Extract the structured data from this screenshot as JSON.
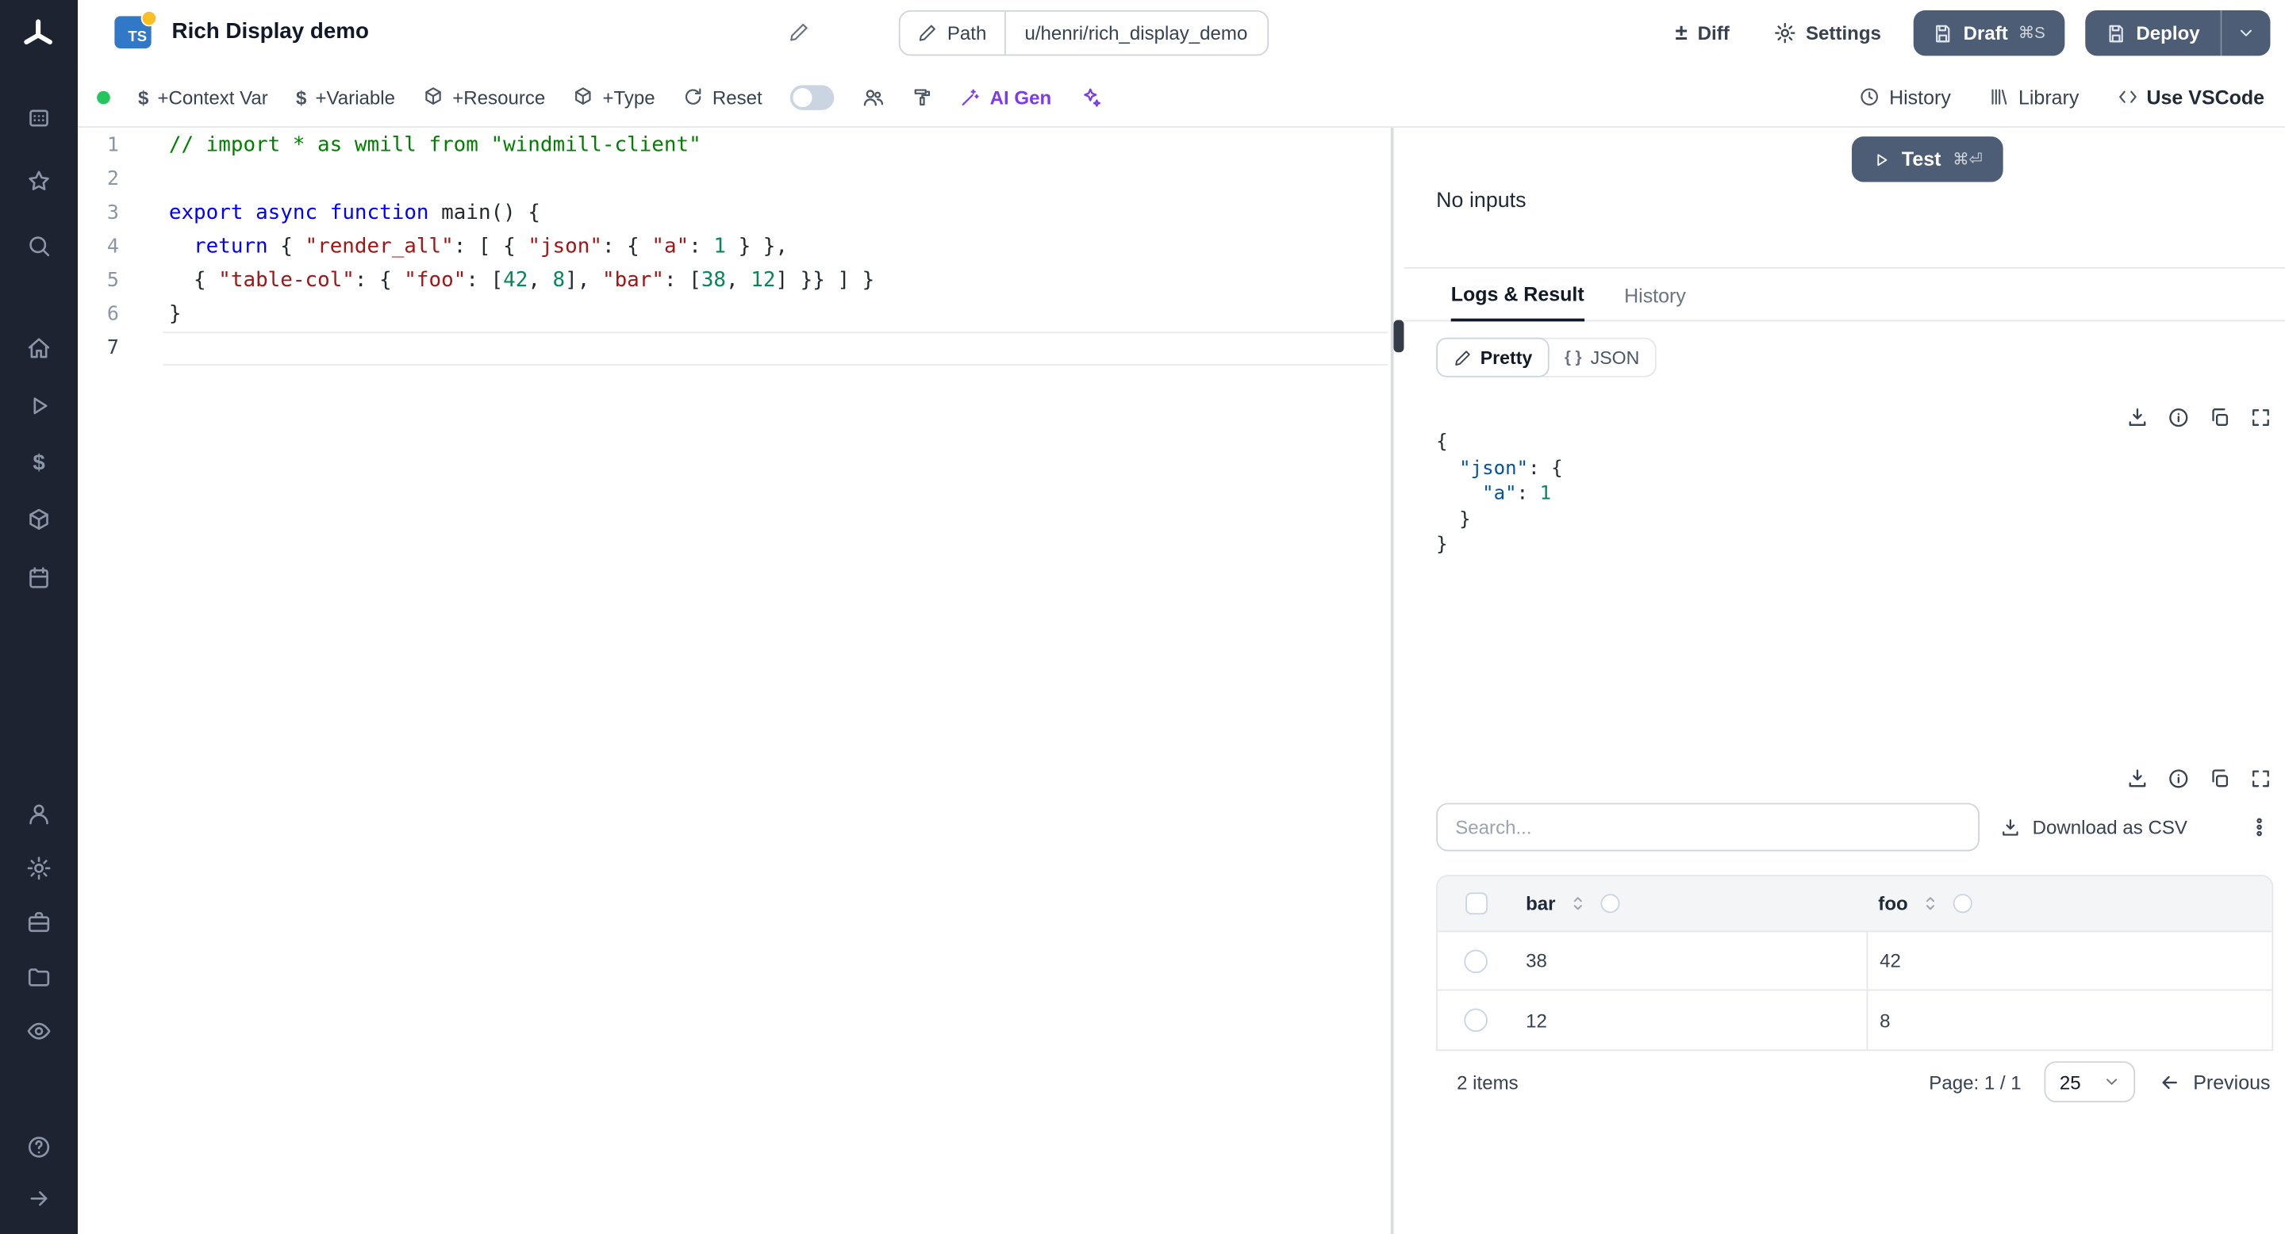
{
  "colors": {
    "sidebar_bg": "#1d2330",
    "primary_button": "#4c5d75",
    "ai_accent": "#7c3aed",
    "ts_badge": "#3178c6",
    "status_green": "#22c55e",
    "code_comment": "#008000",
    "code_keyword": "#0000ff",
    "code_string": "#a31515",
    "code_number": "#098658",
    "json_key": "#0451a5"
  },
  "header": {
    "language_badge": "TS",
    "title": "Rich Display demo",
    "path_label": "Path",
    "path_value": "u/henri/rich_display_demo",
    "diff_label": "Diff",
    "diff_glyph": "±",
    "settings_label": "Settings",
    "draft_label": "Draft",
    "draft_shortcut": "⌘S",
    "deploy_label": "Deploy"
  },
  "toolbar": {
    "add_context_var": "+Context Var",
    "add_variable": "+Variable",
    "add_resource": "+Resource",
    "add_type": "+Type",
    "reset": "Reset",
    "dollar_glyph": "$",
    "ai_gen": "AI Gen",
    "history": "History",
    "library": "Library",
    "use_vscode": "Use VSCode"
  },
  "preview": {
    "test_label": "Test",
    "test_shortcut": "⌘⏎",
    "no_inputs": "No inputs",
    "tab_logs_result": "Logs & Result",
    "tab_history": "History",
    "mode_pretty": "Pretty",
    "mode_json": "JSON",
    "braces_glyph": "{ }"
  },
  "editor": {
    "active_line": 7,
    "line_numbers": [
      1,
      2,
      3,
      4,
      5,
      6,
      7
    ],
    "lines": [
      [
        [
          "comment",
          "// import * as wmill from \"windmill-client\""
        ]
      ],
      [],
      [
        [
          "kw",
          "export"
        ],
        [
          "plain",
          " "
        ],
        [
          "kw",
          "async"
        ],
        [
          "plain",
          " "
        ],
        [
          "kw",
          "function"
        ],
        [
          "plain",
          " "
        ],
        [
          "fn",
          "main"
        ],
        [
          "plain",
          "() {"
        ]
      ],
      [
        [
          "plain",
          "  "
        ],
        [
          "kw",
          "return"
        ],
        [
          "plain",
          " { "
        ],
        [
          "str",
          "\"render_all\""
        ],
        [
          "plain",
          ": [ { "
        ],
        [
          "str",
          "\"json\""
        ],
        [
          "plain",
          ": { "
        ],
        [
          "str",
          "\"a\""
        ],
        [
          "plain",
          ": "
        ],
        [
          "num",
          "1"
        ],
        [
          "plain",
          " } },"
        ]
      ],
      [
        [
          "plain",
          "  { "
        ],
        [
          "str",
          "\"table-col\""
        ],
        [
          "plain",
          ": { "
        ],
        [
          "str",
          "\"foo\""
        ],
        [
          "plain",
          ": ["
        ],
        [
          "num",
          "42"
        ],
        [
          "plain",
          ", "
        ],
        [
          "num",
          "8"
        ],
        [
          "plain",
          "], "
        ],
        [
          "str",
          "\"bar\""
        ],
        [
          "plain",
          ": ["
        ],
        [
          "num",
          "38"
        ],
        [
          "plain",
          ", "
        ],
        [
          "num",
          "12"
        ],
        [
          "plain",
          "] }} ] }"
        ]
      ],
      [
        [
          "plain",
          "}"
        ]
      ],
      []
    ]
  },
  "result": {
    "lines": [
      [
        [
          "plain",
          "{"
        ]
      ],
      [
        [
          "plain",
          "  "
        ],
        [
          "key",
          "\"json\""
        ],
        [
          "plain",
          ": {"
        ]
      ],
      [
        [
          "plain",
          "    "
        ],
        [
          "key",
          "\"a\""
        ],
        [
          "plain",
          ": "
        ],
        [
          "num",
          "1"
        ]
      ],
      [
        [
          "plain",
          "  }"
        ]
      ],
      [
        [
          "plain",
          "}"
        ]
      ]
    ]
  },
  "table": {
    "search_placeholder": "Search...",
    "download_csv": "Download as CSV",
    "columns": [
      "bar",
      "foo"
    ],
    "rows": [
      [
        "38",
        "42"
      ],
      [
        "12",
        "8"
      ]
    ],
    "items_count": "2 items",
    "page_info": "Page: 1 / 1",
    "page_size": "25",
    "previous": "Previous"
  },
  "sidebar": {
    "icons": [
      "windmill-logo",
      "apps",
      "favorites-star",
      "search",
      "home",
      "runs-play",
      "variables-dollar",
      "resources-cube",
      "schedules-calendar",
      "users-person",
      "settings-gear",
      "workers-briefcase",
      "folders",
      "audit-eye",
      "help-question",
      "collapse-arrow"
    ]
  }
}
